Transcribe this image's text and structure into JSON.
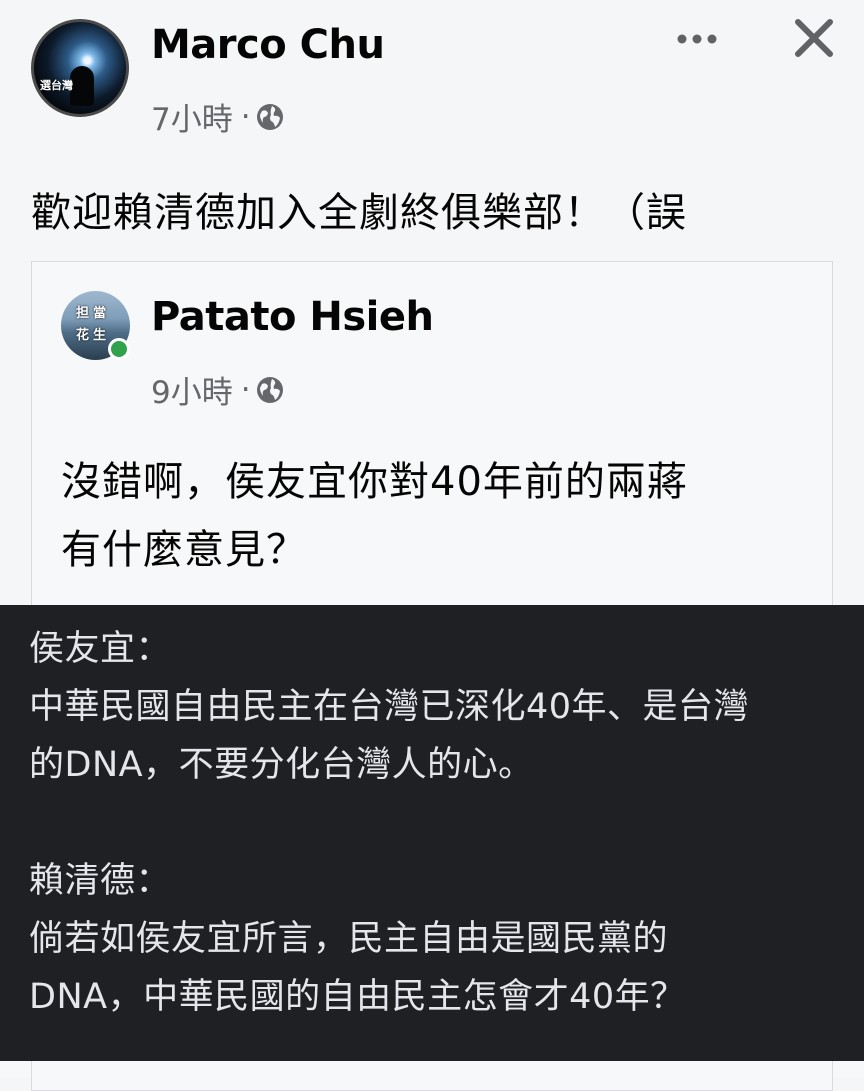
{
  "post": {
    "author": "Marco Chu",
    "time": "7小時",
    "separator": "·",
    "avatar_logo": "選台灣",
    "text": "歡迎賴清德加入全劇終俱樂部！（誤"
  },
  "shared_post": {
    "author": "Patato Hsieh",
    "time": "9小時",
    "separator": "·",
    "avatar_sign": [
      "担",
      "當",
      "花",
      "生"
    ],
    "text_lines": [
      "沒錯啊，侯友宜你對40年前的兩蔣",
      "有什麼意見？"
    ]
  },
  "overlay": {
    "lines": [
      "侯友宜：",
      "中華民國自由民主在台灣已深化40年、是台灣",
      "的DNA，不要分化台灣人的心。",
      "",
      "賴清德：",
      "倘若如侯友宜所言，民主自由是國民黨的",
      "DNA，中華民國的自由民主怎會才40年？"
    ]
  },
  "icons": {
    "more": "more-horizontal-icon",
    "close": "close-icon",
    "privacy": "globe-icon"
  },
  "colors": {
    "background": "#f5f6f7",
    "meta_text": "#65676b",
    "overlay_bg": "#1e2024",
    "overlay_text": "#e4e6eb",
    "online": "#31a24c"
  }
}
